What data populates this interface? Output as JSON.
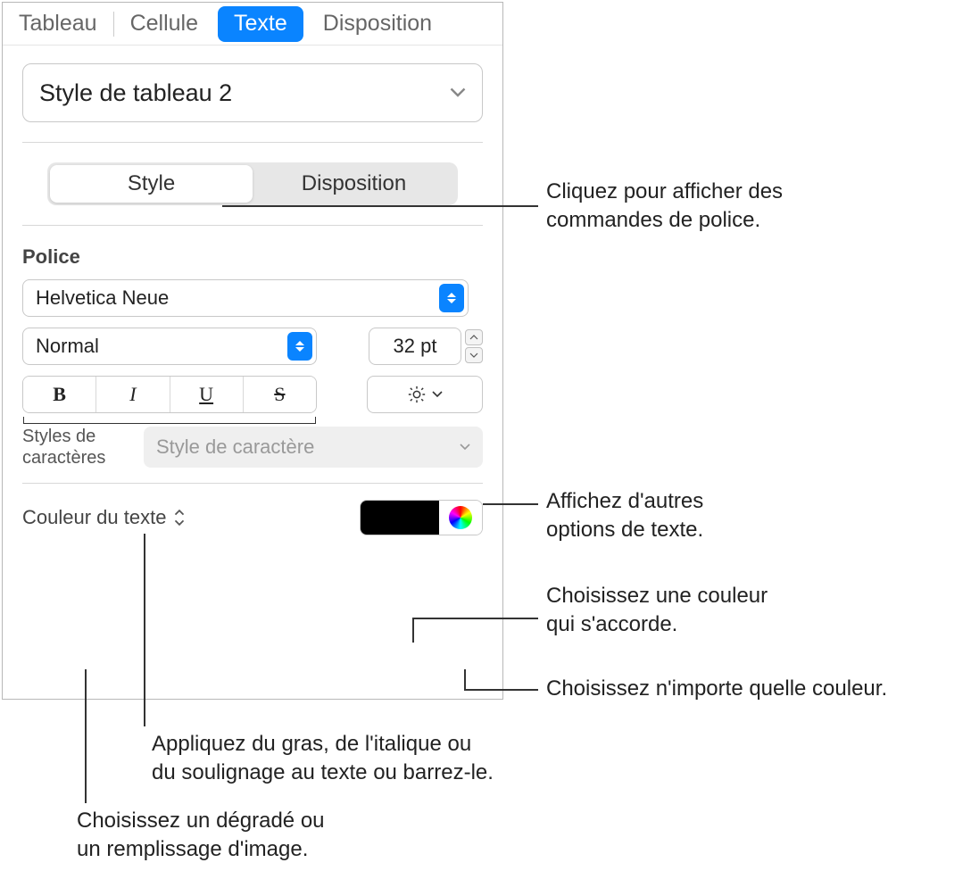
{
  "top_tabs": {
    "tableau": "Tableau",
    "cellule": "Cellule",
    "texte": "Texte",
    "disposition": "Disposition"
  },
  "paragraph_style": "Style de tableau 2",
  "sub_tabs": {
    "style": "Style",
    "disposition": "Disposition"
  },
  "font_section_label": "Police",
  "font_family": "Helvetica Neue",
  "font_weight": "Normal",
  "font_size": "32 pt",
  "bius": {
    "b": "B",
    "i": "I",
    "u": "U",
    "s": "S"
  },
  "char_styles_label": "Styles de\ncaractères",
  "char_style_placeholder": "Style de caractère",
  "text_color_label": "Couleur du texte",
  "callouts": {
    "font_controls": "Cliquez pour afficher des\ncommandes de police.",
    "more_options": "Affichez d'autres\noptions de texte.",
    "matching_color": "Choisissez une couleur\nqui s'accorde.",
    "any_color": "Choisissez n'importe quelle couleur.",
    "bius": "Appliquez du gras, de l'italique ou\ndu soulignage au texte ou barrez-le.",
    "gradient": "Choisissez un dégradé ou\nun remplissage d'image."
  }
}
